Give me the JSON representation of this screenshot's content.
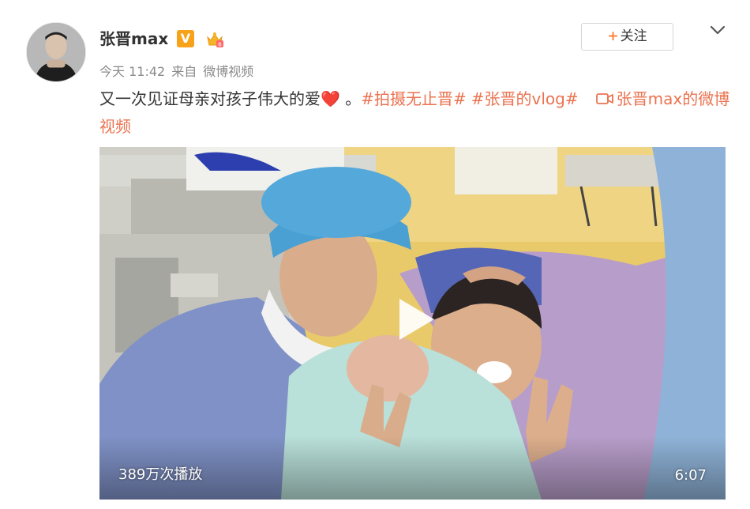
{
  "user": {
    "name": "张晋max",
    "verified_badge": "V",
    "avatar_icon": "avatar-man"
  },
  "meta": {
    "time": "今天 11:42",
    "from_prefix": "来自",
    "source": "微博视频"
  },
  "follow": {
    "plus": "+",
    "label": "关注"
  },
  "post": {
    "text": "又一次见证母亲对孩子伟大的爱",
    "heart": "❤️",
    "period": " 。",
    "topics": [
      "#拍摄无止晋#",
      "#张晋的vlog#"
    ],
    "video_link": "张晋max的微博视频"
  },
  "video": {
    "views": "389万次播放",
    "duration": "6:07"
  },
  "colors": {
    "accent": "#eb7350",
    "verified": "#f7a219",
    "muted": "#8a8a8a"
  }
}
